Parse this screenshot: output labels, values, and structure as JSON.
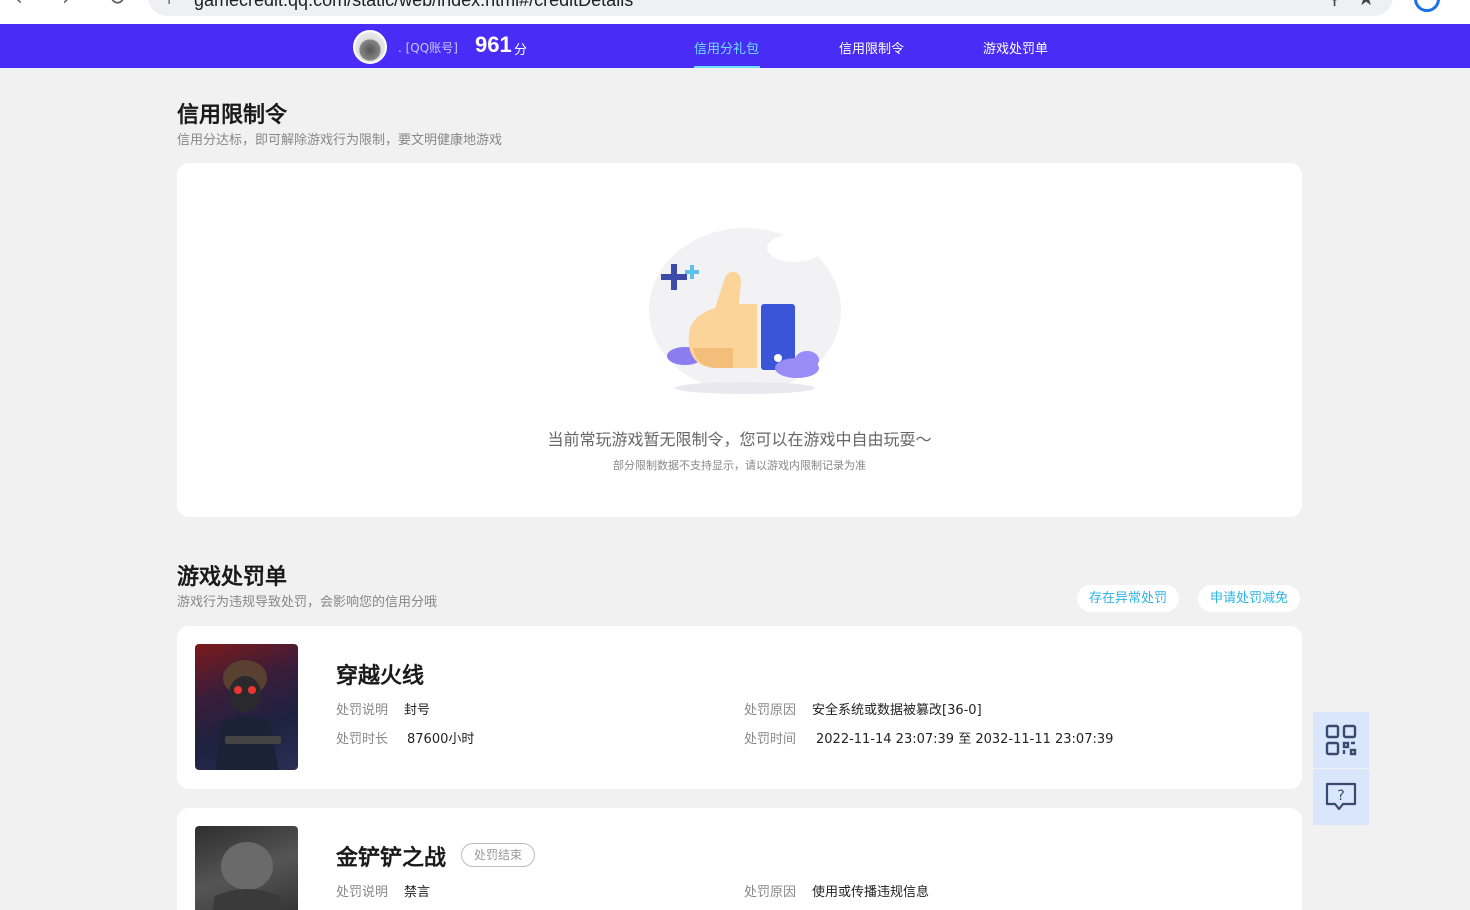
{
  "browser": {
    "url": "gamecredit.qq.com/static/web/index.html#/creditDetails"
  },
  "topnav": {
    "account_label": ". [QQ账号]",
    "score": "961",
    "score_unit": "分",
    "tabs": [
      {
        "label": "信用分礼包",
        "active": true
      },
      {
        "label": "信用限制令",
        "active": false
      },
      {
        "label": "游戏处罚单",
        "active": false
      }
    ]
  },
  "restriction": {
    "title": "信用限制令",
    "subtitle": "信用分达标，即可解除游戏行为限制，要文明健康地游戏",
    "empty_main": "当前常玩游戏暂无限制令，您可以在游戏中自由玩耍～",
    "empty_sub": "部分限制数据不支持显示，请以游戏内限制记录为准"
  },
  "penalty": {
    "title": "游戏处罚单",
    "subtitle": "游戏行为违规导致处罚，会影响您的信用分哦",
    "actions": [
      "存在异常处罚",
      "申请处罚减免"
    ],
    "games": [
      {
        "name": "穿越火线",
        "badge": "",
        "desc_label": "处罚说明",
        "desc_value": "封号",
        "reason_label": "处罚原因",
        "reason_value": "安全系统或数据被篡改[36-0]",
        "duration_label": "处罚时长",
        "duration_value": "87600小时",
        "time_label": "处罚时间",
        "time_value": "2022-11-14 23:07:39 至 2032-11-11 23:07:39"
      },
      {
        "name": "金铲铲之战",
        "badge": "处罚结束",
        "desc_label": "处罚说明",
        "desc_value": "禁言",
        "reason_label": "处罚原因",
        "reason_value": "使用或传播违规信息"
      }
    ]
  },
  "float": {
    "icons": [
      "qr-code-icon",
      "help-feedback-icon"
    ]
  },
  "colors": {
    "nav_bg": "#4a2cf7",
    "accent": "#6ee0ff",
    "link": "#2bb5e6",
    "page_bg": "#f1f1f1"
  }
}
